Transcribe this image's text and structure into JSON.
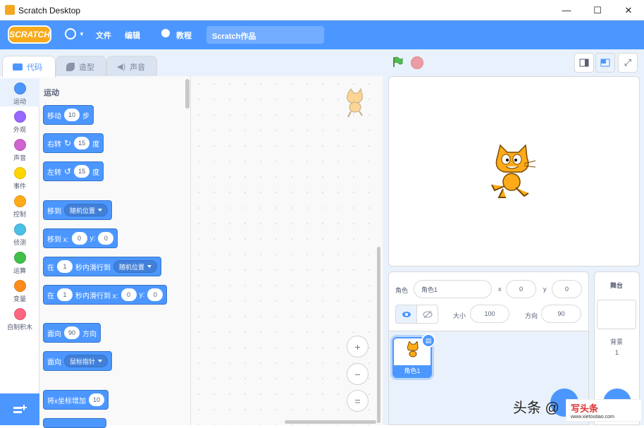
{
  "window": {
    "title": "Scratch Desktop",
    "min": "—",
    "max": "☐",
    "close": "✕"
  },
  "menu": {
    "logo": "SCRATCH",
    "file": "文件",
    "edit": "编辑",
    "tutorials": "教程",
    "project_name": "Scratch作品"
  },
  "tabs": [
    {
      "label": "代码"
    },
    {
      "label": "造型"
    },
    {
      "label": "声音"
    }
  ],
  "categories": [
    {
      "label": "运动",
      "color": "#4c97ff"
    },
    {
      "label": "外观",
      "color": "#9966ff"
    },
    {
      "label": "声音",
      "color": "#cf63cf"
    },
    {
      "label": "事件",
      "color": "#ffd500"
    },
    {
      "label": "控制",
      "color": "#ffab19"
    },
    {
      "label": "侦测",
      "color": "#4cbfe6"
    },
    {
      "label": "运算",
      "color": "#40bf4a"
    },
    {
      "label": "变量",
      "color": "#ff8c1a"
    },
    {
      "label": "自制积木",
      "color": "#ff6680"
    }
  ],
  "palette": {
    "section": "运动",
    "b1": {
      "a": "移动",
      "v": "10",
      "b": "步"
    },
    "b2": {
      "a": "右转",
      "v": "15",
      "b": "度",
      "icon": "rotate-right-icon"
    },
    "b3": {
      "a": "左转",
      "v": "15",
      "b": "度",
      "icon": "rotate-left-icon"
    },
    "b4": {
      "a": "移到",
      "dd": "随机位置"
    },
    "b5": {
      "a": "移到 x:",
      "x": "0",
      "y_label": "y:",
      "y": "0"
    },
    "b6": {
      "a": "在",
      "v": "1",
      "b": "秒内滑行到",
      "dd": "随机位置"
    },
    "b7": {
      "a": "在",
      "v": "1",
      "b": "秒内滑行到 x:",
      "x": "0",
      "y_label": "y:",
      "y": "0"
    },
    "b8": {
      "a": "面向",
      "v": "90",
      "b": "方向"
    },
    "b9": {
      "a": "面向",
      "dd": "鼠标指针"
    },
    "b10": {
      "a": "将x坐标增加",
      "v": "10"
    }
  },
  "zoom": {
    "in": "+",
    "out": "−",
    "reset": "="
  },
  "sprite": {
    "label": "角色",
    "name": "角色1",
    "x_label": "x",
    "x": "0",
    "y_label": "y",
    "y": "0",
    "size_label": "大小",
    "size": "100",
    "dir_label": "方向",
    "dir": "90",
    "card_name": "角色1"
  },
  "stage_panel": {
    "title": "舞台",
    "backdrop_label": "背景",
    "backdrop_count": "1"
  },
  "watermark": {
    "text": "头条 @",
    "site": "写头条",
    "url": "www.xietoutiao.com"
  }
}
